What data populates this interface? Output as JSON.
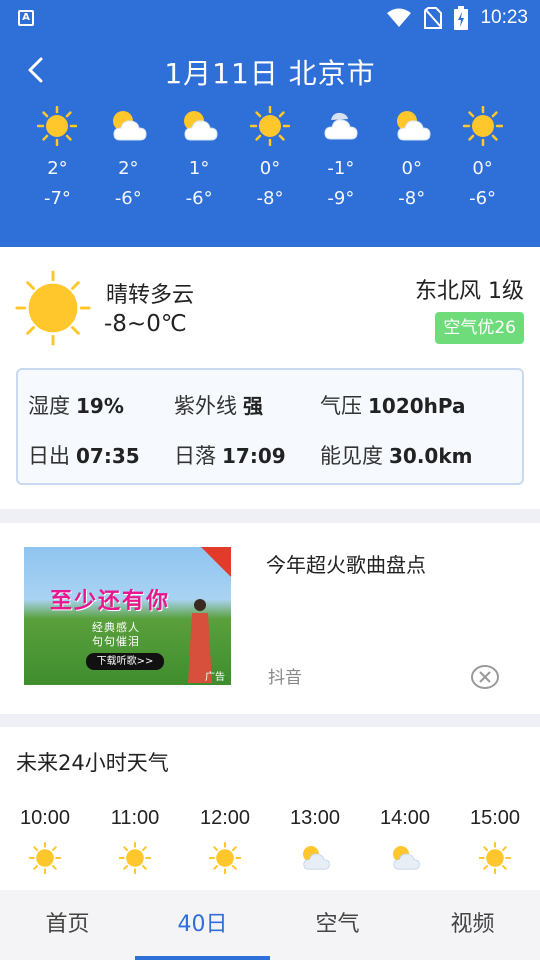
{
  "status_bar": {
    "time": "10:23"
  },
  "header": {
    "title": "1月11日 北京市",
    "days": [
      {
        "icon": "sunny",
        "high": "2°",
        "low": "-7°"
      },
      {
        "icon": "partly-cloudy",
        "high": "2°",
        "low": "-6°"
      },
      {
        "icon": "partly-cloudy",
        "high": "1°",
        "low": "-6°"
      },
      {
        "icon": "sunny",
        "high": "0°",
        "low": "-8°"
      },
      {
        "icon": "cloudy",
        "high": "-1°",
        "low": "-9°"
      },
      {
        "icon": "partly-cloudy",
        "high": "0°",
        "low": "-8°"
      },
      {
        "icon": "sunny",
        "high": "0°",
        "low": "-6°"
      }
    ]
  },
  "current": {
    "condition": "晴转多云",
    "temp_range": "-8~0℃",
    "wind": "东北风 1级",
    "aqi": "空气优26",
    "stats": {
      "humidity_label": "湿度",
      "humidity": "19%",
      "uv_label": "紫外线",
      "uv": "强",
      "pressure_label": "气压",
      "pressure": "1020hPa",
      "sunrise_label": "日出",
      "sunrise": "07:35",
      "sunset_label": "日落",
      "sunset": "17:09",
      "visibility_label": "能见度",
      "visibility": "30.0km"
    }
  },
  "ad": {
    "image_title": "至少还有你",
    "image_line1": "经典感人",
    "image_line2": "句句催泪",
    "image_button": "下载听歌>>",
    "image_tag": "广告",
    "headline": "今年超火歌曲盘点",
    "source": "抖音"
  },
  "hourly": {
    "title": "未来24小时天气",
    "hours": [
      {
        "time": "10:00",
        "icon": "sunny"
      },
      {
        "time": "11:00",
        "icon": "sunny"
      },
      {
        "time": "12:00",
        "icon": "sunny"
      },
      {
        "time": "13:00",
        "icon": "partly-cloudy"
      },
      {
        "time": "14:00",
        "icon": "partly-cloudy"
      },
      {
        "time": "15:00",
        "icon": "sunny"
      }
    ]
  },
  "tabs": [
    {
      "label": "首页",
      "active": false
    },
    {
      "label": "40日",
      "active": true
    },
    {
      "label": "空气",
      "active": false
    },
    {
      "label": "视频",
      "active": false
    }
  ],
  "colors": {
    "header_bg": "#2f6fd8",
    "accent": "#2f6fd8",
    "aqi_good": "#6edc7a",
    "sun": "#ffc72c"
  }
}
